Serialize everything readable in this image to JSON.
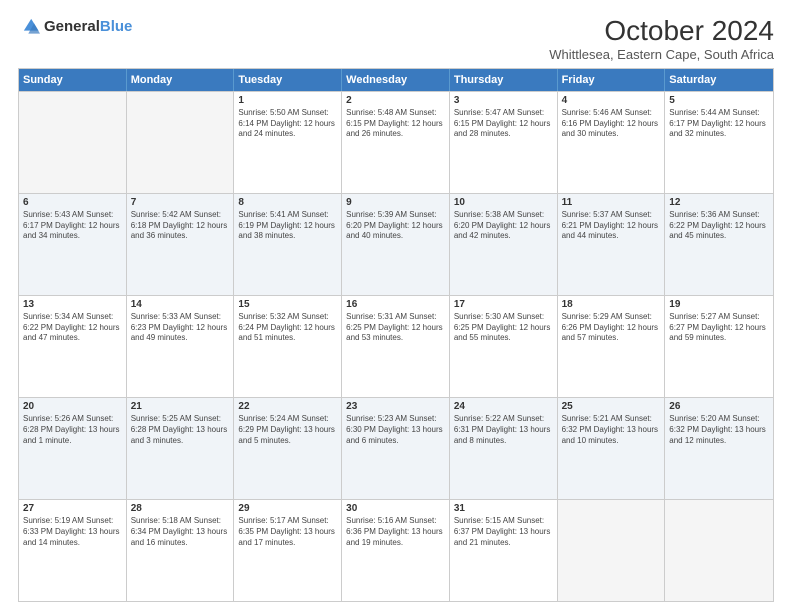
{
  "logo": {
    "general": "General",
    "blue": "Blue"
  },
  "header": {
    "month": "October 2024",
    "location": "Whittlesea, Eastern Cape, South Africa"
  },
  "days": [
    "Sunday",
    "Monday",
    "Tuesday",
    "Wednesday",
    "Thursday",
    "Friday",
    "Saturday"
  ],
  "weeks": [
    [
      {
        "day": "",
        "empty": true
      },
      {
        "day": "",
        "empty": true
      },
      {
        "day": "1",
        "info": "Sunrise: 5:50 AM\nSunset: 6:14 PM\nDaylight: 12 hours\nand 24 minutes."
      },
      {
        "day": "2",
        "info": "Sunrise: 5:48 AM\nSunset: 6:15 PM\nDaylight: 12 hours\nand 26 minutes."
      },
      {
        "day": "3",
        "info": "Sunrise: 5:47 AM\nSunset: 6:15 PM\nDaylight: 12 hours\nand 28 minutes."
      },
      {
        "day": "4",
        "info": "Sunrise: 5:46 AM\nSunset: 6:16 PM\nDaylight: 12 hours\nand 30 minutes."
      },
      {
        "day": "5",
        "info": "Sunrise: 5:44 AM\nSunset: 6:17 PM\nDaylight: 12 hours\nand 32 minutes."
      }
    ],
    [
      {
        "day": "6",
        "info": "Sunrise: 5:43 AM\nSunset: 6:17 PM\nDaylight: 12 hours\nand 34 minutes."
      },
      {
        "day": "7",
        "info": "Sunrise: 5:42 AM\nSunset: 6:18 PM\nDaylight: 12 hours\nand 36 minutes."
      },
      {
        "day": "8",
        "info": "Sunrise: 5:41 AM\nSunset: 6:19 PM\nDaylight: 12 hours\nand 38 minutes."
      },
      {
        "day": "9",
        "info": "Sunrise: 5:39 AM\nSunset: 6:20 PM\nDaylight: 12 hours\nand 40 minutes."
      },
      {
        "day": "10",
        "info": "Sunrise: 5:38 AM\nSunset: 6:20 PM\nDaylight: 12 hours\nand 42 minutes."
      },
      {
        "day": "11",
        "info": "Sunrise: 5:37 AM\nSunset: 6:21 PM\nDaylight: 12 hours\nand 44 minutes."
      },
      {
        "day": "12",
        "info": "Sunrise: 5:36 AM\nSunset: 6:22 PM\nDaylight: 12 hours\nand 45 minutes."
      }
    ],
    [
      {
        "day": "13",
        "info": "Sunrise: 5:34 AM\nSunset: 6:22 PM\nDaylight: 12 hours\nand 47 minutes."
      },
      {
        "day": "14",
        "info": "Sunrise: 5:33 AM\nSunset: 6:23 PM\nDaylight: 12 hours\nand 49 minutes."
      },
      {
        "day": "15",
        "info": "Sunrise: 5:32 AM\nSunset: 6:24 PM\nDaylight: 12 hours\nand 51 minutes."
      },
      {
        "day": "16",
        "info": "Sunrise: 5:31 AM\nSunset: 6:25 PM\nDaylight: 12 hours\nand 53 minutes."
      },
      {
        "day": "17",
        "info": "Sunrise: 5:30 AM\nSunset: 6:25 PM\nDaylight: 12 hours\nand 55 minutes."
      },
      {
        "day": "18",
        "info": "Sunrise: 5:29 AM\nSunset: 6:26 PM\nDaylight: 12 hours\nand 57 minutes."
      },
      {
        "day": "19",
        "info": "Sunrise: 5:27 AM\nSunset: 6:27 PM\nDaylight: 12 hours\nand 59 minutes."
      }
    ],
    [
      {
        "day": "20",
        "info": "Sunrise: 5:26 AM\nSunset: 6:28 PM\nDaylight: 13 hours\nand 1 minute."
      },
      {
        "day": "21",
        "info": "Sunrise: 5:25 AM\nSunset: 6:28 PM\nDaylight: 13 hours\nand 3 minutes."
      },
      {
        "day": "22",
        "info": "Sunrise: 5:24 AM\nSunset: 6:29 PM\nDaylight: 13 hours\nand 5 minutes."
      },
      {
        "day": "23",
        "info": "Sunrise: 5:23 AM\nSunset: 6:30 PM\nDaylight: 13 hours\nand 6 minutes."
      },
      {
        "day": "24",
        "info": "Sunrise: 5:22 AM\nSunset: 6:31 PM\nDaylight: 13 hours\nand 8 minutes."
      },
      {
        "day": "25",
        "info": "Sunrise: 5:21 AM\nSunset: 6:32 PM\nDaylight: 13 hours\nand 10 minutes."
      },
      {
        "day": "26",
        "info": "Sunrise: 5:20 AM\nSunset: 6:32 PM\nDaylight: 13 hours\nand 12 minutes."
      }
    ],
    [
      {
        "day": "27",
        "info": "Sunrise: 5:19 AM\nSunset: 6:33 PM\nDaylight: 13 hours\nand 14 minutes."
      },
      {
        "day": "28",
        "info": "Sunrise: 5:18 AM\nSunset: 6:34 PM\nDaylight: 13 hours\nand 16 minutes."
      },
      {
        "day": "29",
        "info": "Sunrise: 5:17 AM\nSunset: 6:35 PM\nDaylight: 13 hours\nand 17 minutes."
      },
      {
        "day": "30",
        "info": "Sunrise: 5:16 AM\nSunset: 6:36 PM\nDaylight: 13 hours\nand 19 minutes."
      },
      {
        "day": "31",
        "info": "Sunrise: 5:15 AM\nSunset: 6:37 PM\nDaylight: 13 hours\nand 21 minutes."
      },
      {
        "day": "",
        "empty": true
      },
      {
        "day": "",
        "empty": true
      }
    ]
  ]
}
